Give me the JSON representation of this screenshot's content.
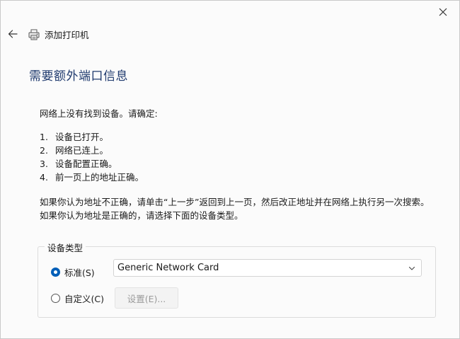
{
  "window": {
    "title": "添加打印机"
  },
  "heading": "需要额外端口信息",
  "intro": "网络上没有找到设备。请确定:",
  "checklist": [
    {
      "num": "1.",
      "text": "设备已打开。"
    },
    {
      "num": "2.",
      "text": "网络已连上。"
    },
    {
      "num": "3.",
      "text": "设备配置正确。"
    },
    {
      "num": "4.",
      "text": "前一页上的地址正确。"
    }
  ],
  "paragraph": {
    "line1": "如果你认为地址不正确，请单击“上一步”返回到上一页，然后改正地址并在网络上执行另一次搜索。",
    "line2": "如果你认为地址是正确的，请选择下面的设备类型。"
  },
  "device_type": {
    "legend": "设备类型",
    "standard_label": "标准(S)",
    "standard_checked": true,
    "selected_card": "Generic Network Card",
    "custom_label": "自定义(C)",
    "custom_checked": false,
    "settings_label": "设置(E)..."
  },
  "icons": {
    "close": "close-icon",
    "back": "back-arrow-icon",
    "printer": "printer-icon",
    "dropdown": "chevron-down-icon"
  },
  "colors": {
    "accent": "#005fb8",
    "heading": "#1f3a6e",
    "disabled_text": "#9a9a9a"
  }
}
